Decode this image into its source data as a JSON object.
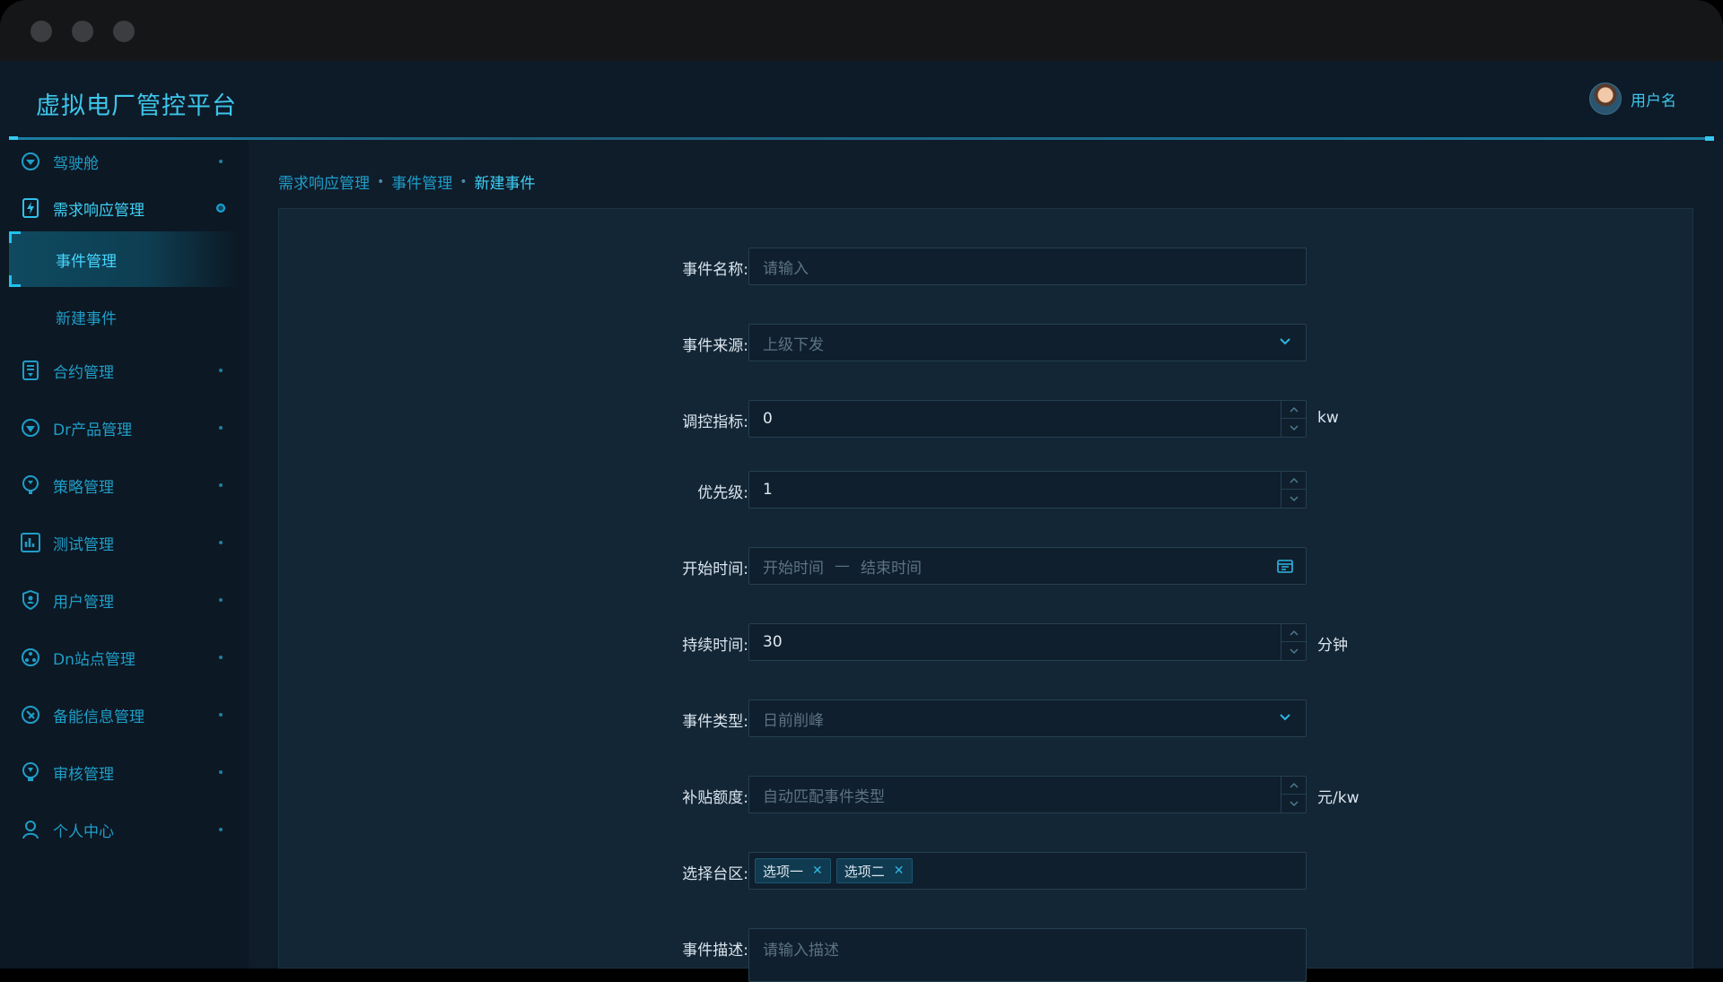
{
  "app": {
    "title": "虚拟电厂管控平台",
    "user": "用户名"
  },
  "sidebar": {
    "items": [
      {
        "label": "驾驶舱",
        "icon": "dashboard-icon"
      },
      {
        "label": "需求响应管理",
        "icon": "lightning-icon"
      },
      {
        "label": "事件管理",
        "sub": true
      },
      {
        "label": "新建事件",
        "sub": true
      },
      {
        "label": "合约管理",
        "icon": "contract-icon"
      },
      {
        "label": "Dr产品管理",
        "icon": "product-icon"
      },
      {
        "label": "策略管理",
        "icon": "strategy-icon"
      },
      {
        "label": "测试管理",
        "icon": "chart-icon"
      },
      {
        "label": "用户管理",
        "icon": "user-shield-icon"
      },
      {
        "label": "Dn站点管理",
        "icon": "site-icon"
      },
      {
        "label": "备能信息管理",
        "icon": "energy-icon"
      },
      {
        "label": "审核管理",
        "icon": "audit-icon"
      },
      {
        "label": "个人中心",
        "icon": "person-icon"
      }
    ]
  },
  "breadcrumb": [
    "需求响应管理",
    "事件管理",
    "新建事件"
  ],
  "breadcrumb_sep": "•",
  "form": {
    "event_name": {
      "label": "事件名称:",
      "placeholder": "请输入"
    },
    "event_source": {
      "label": "事件来源:",
      "value": "上级下发"
    },
    "control_target": {
      "label": "调控指标:",
      "value": "0",
      "unit": "kw"
    },
    "priority": {
      "label": "优先级:",
      "value": "1"
    },
    "start_time": {
      "label": "开始时间:",
      "placeholder_start": "开始时间",
      "separator": "—",
      "placeholder_end": "结束时间"
    },
    "duration": {
      "label": "持续时间:",
      "value": "30",
      "unit": "分钟"
    },
    "event_type": {
      "label": "事件类型:",
      "value": "日前削峰"
    },
    "subsidy": {
      "label": "补贴额度:",
      "placeholder": "自动匹配事件类型",
      "unit": "元/kw"
    },
    "district": {
      "label": "选择台区:",
      "tags": [
        "选项一",
        "选项二"
      ]
    },
    "description": {
      "label": "事件描述:",
      "placeholder": "请输入描述"
    }
  },
  "colors": {
    "accent": "#3dc6ea",
    "bg": "#0f1c2a",
    "panel": "#132635"
  }
}
